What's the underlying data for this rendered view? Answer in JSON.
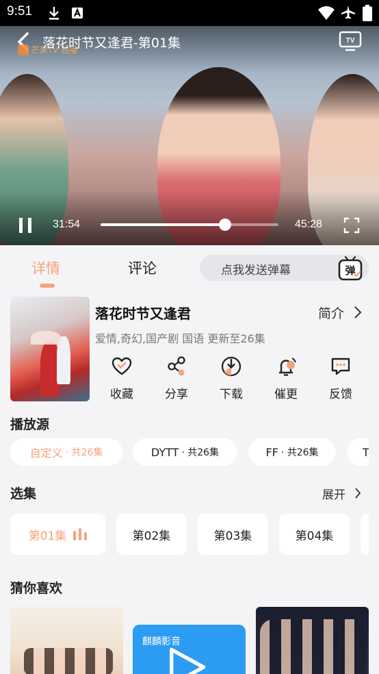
{
  "status_bar": {
    "time": "9:51"
  },
  "player": {
    "title": "落花时节又逢君-第01集",
    "current_time": "31:54",
    "total_time": "45:28",
    "progress_fraction": 0.7,
    "watermark": "芒果TV 独播"
  },
  "tabs": {
    "details": "详情",
    "comments": "评论",
    "danmu_placeholder": "点我发送弹幕",
    "danmu_icon_text": "弹"
  },
  "show": {
    "title": "落花时节又逢君",
    "intro_label": "简介",
    "meta": "爱情,奇幻,国产剧 国语 更新至26集"
  },
  "actions": [
    {
      "label": "收藏",
      "icon": "heart-icon"
    },
    {
      "label": "分享",
      "icon": "share-icon"
    },
    {
      "label": "下载",
      "icon": "download-icon"
    },
    {
      "label": "催更",
      "icon": "bell-icon"
    },
    {
      "label": "反馈",
      "icon": "feedback-icon"
    }
  ],
  "sources": {
    "title": "播放源",
    "items": [
      {
        "name": "自定义",
        "count": "· 共26集"
      },
      {
        "name": "DYTT",
        "count": "· 共26集"
      },
      {
        "name": "FF",
        "count": "· 共26集"
      },
      {
        "name": "T",
        "count": ""
      }
    ]
  },
  "episodes": {
    "title": "选集",
    "expand_label": "展开",
    "items": [
      "第01集",
      "第02集",
      "第03集",
      "第04集"
    ]
  },
  "recommend": {
    "title": "猜你喜欢",
    "card2_label": "麒麟影音"
  },
  "colors": {
    "accent": "#f3a47c",
    "background": "#f4f4f6"
  }
}
